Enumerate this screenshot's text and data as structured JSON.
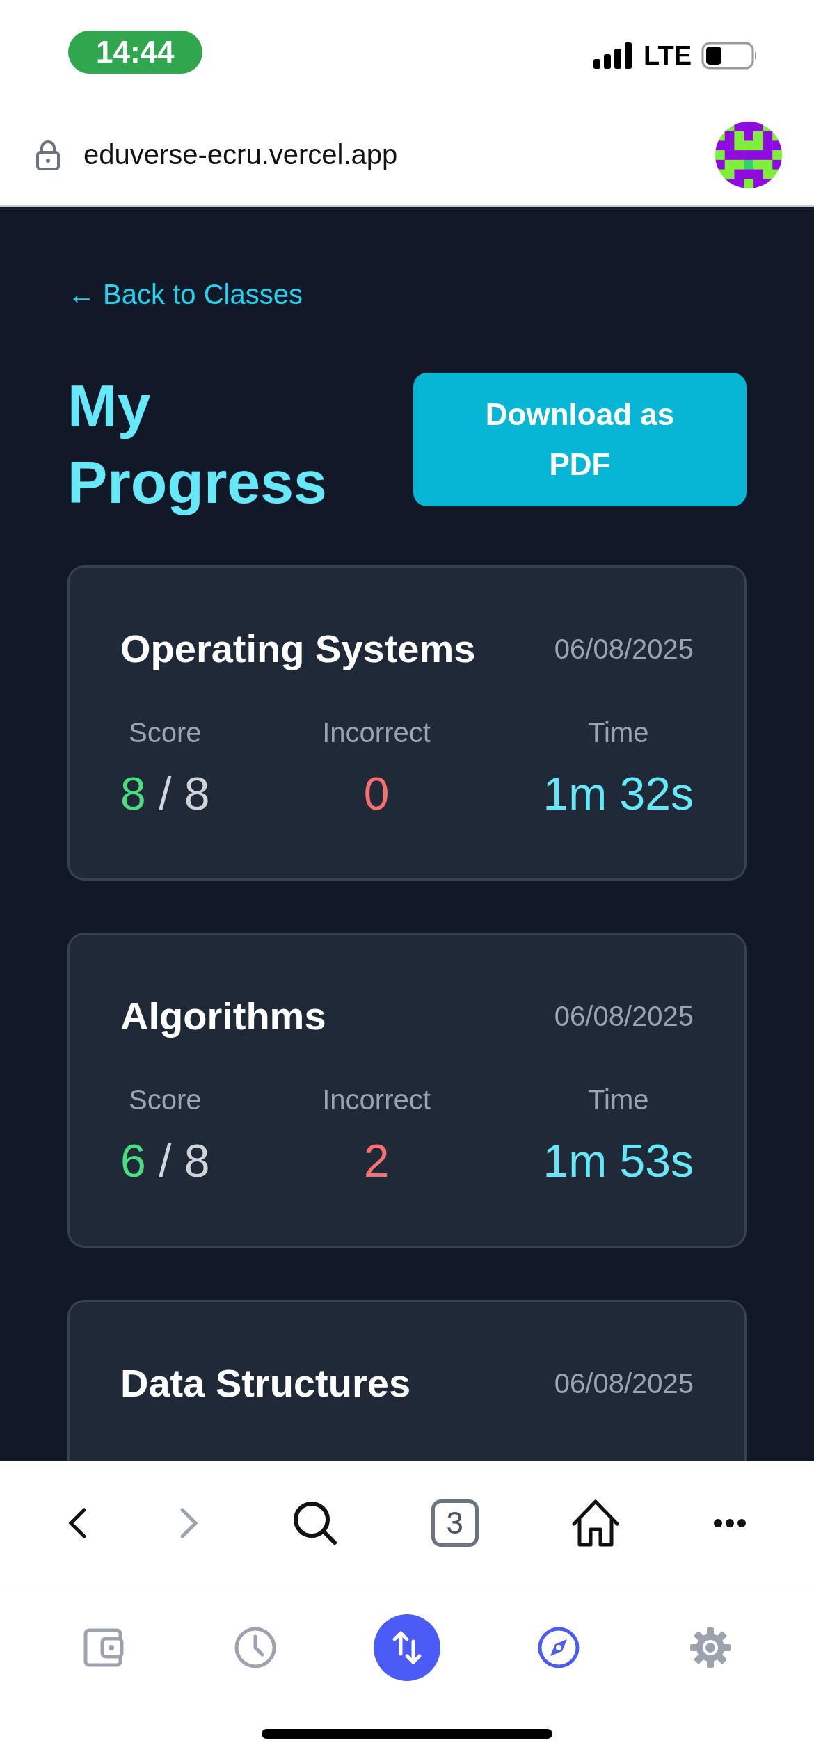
{
  "status_bar": {
    "time": "14:44",
    "network": "LTE"
  },
  "address_bar": {
    "url": "eduverse-ecru.vercel.app"
  },
  "page": {
    "back_link": "← Back to Classes",
    "title": "My Progress",
    "download_button": "Download as PDF",
    "results": [
      {
        "subject": "Operating Systems",
        "date": "06/08/2025",
        "score_label": "Score",
        "score": "8",
        "separator": "/",
        "total": "8",
        "incorrect_label": "Incorrect",
        "incorrect": "0",
        "time_label": "Time",
        "time": "1m 32s"
      },
      {
        "subject": "Algorithms",
        "date": "06/08/2025",
        "score_label": "Score",
        "score": "6",
        "separator": "/",
        "total": "8",
        "incorrect_label": "Incorrect",
        "incorrect": "2",
        "time_label": "Time",
        "time": "1m 53s"
      },
      {
        "subject": "Data Structures",
        "date": "06/08/2025"
      }
    ]
  },
  "browser_toolbar": [
    {
      "kind": "back",
      "disabled": false
    },
    {
      "kind": "forward",
      "disabled": true
    },
    {
      "kind": "search",
      "disabled": false
    },
    {
      "kind": "tabs",
      "count": "3",
      "disabled": false
    },
    {
      "kind": "home",
      "disabled": false
    },
    {
      "kind": "more",
      "disabled": false
    }
  ],
  "tab_bar": [
    {
      "kind": "wallet",
      "selected": false,
      "active": false
    },
    {
      "kind": "history",
      "selected": false,
      "active": false
    },
    {
      "kind": "swap",
      "selected": true,
      "active": false
    },
    {
      "kind": "compass",
      "selected": false,
      "active": true
    },
    {
      "kind": "settings",
      "selected": false,
      "active": false
    }
  ]
}
